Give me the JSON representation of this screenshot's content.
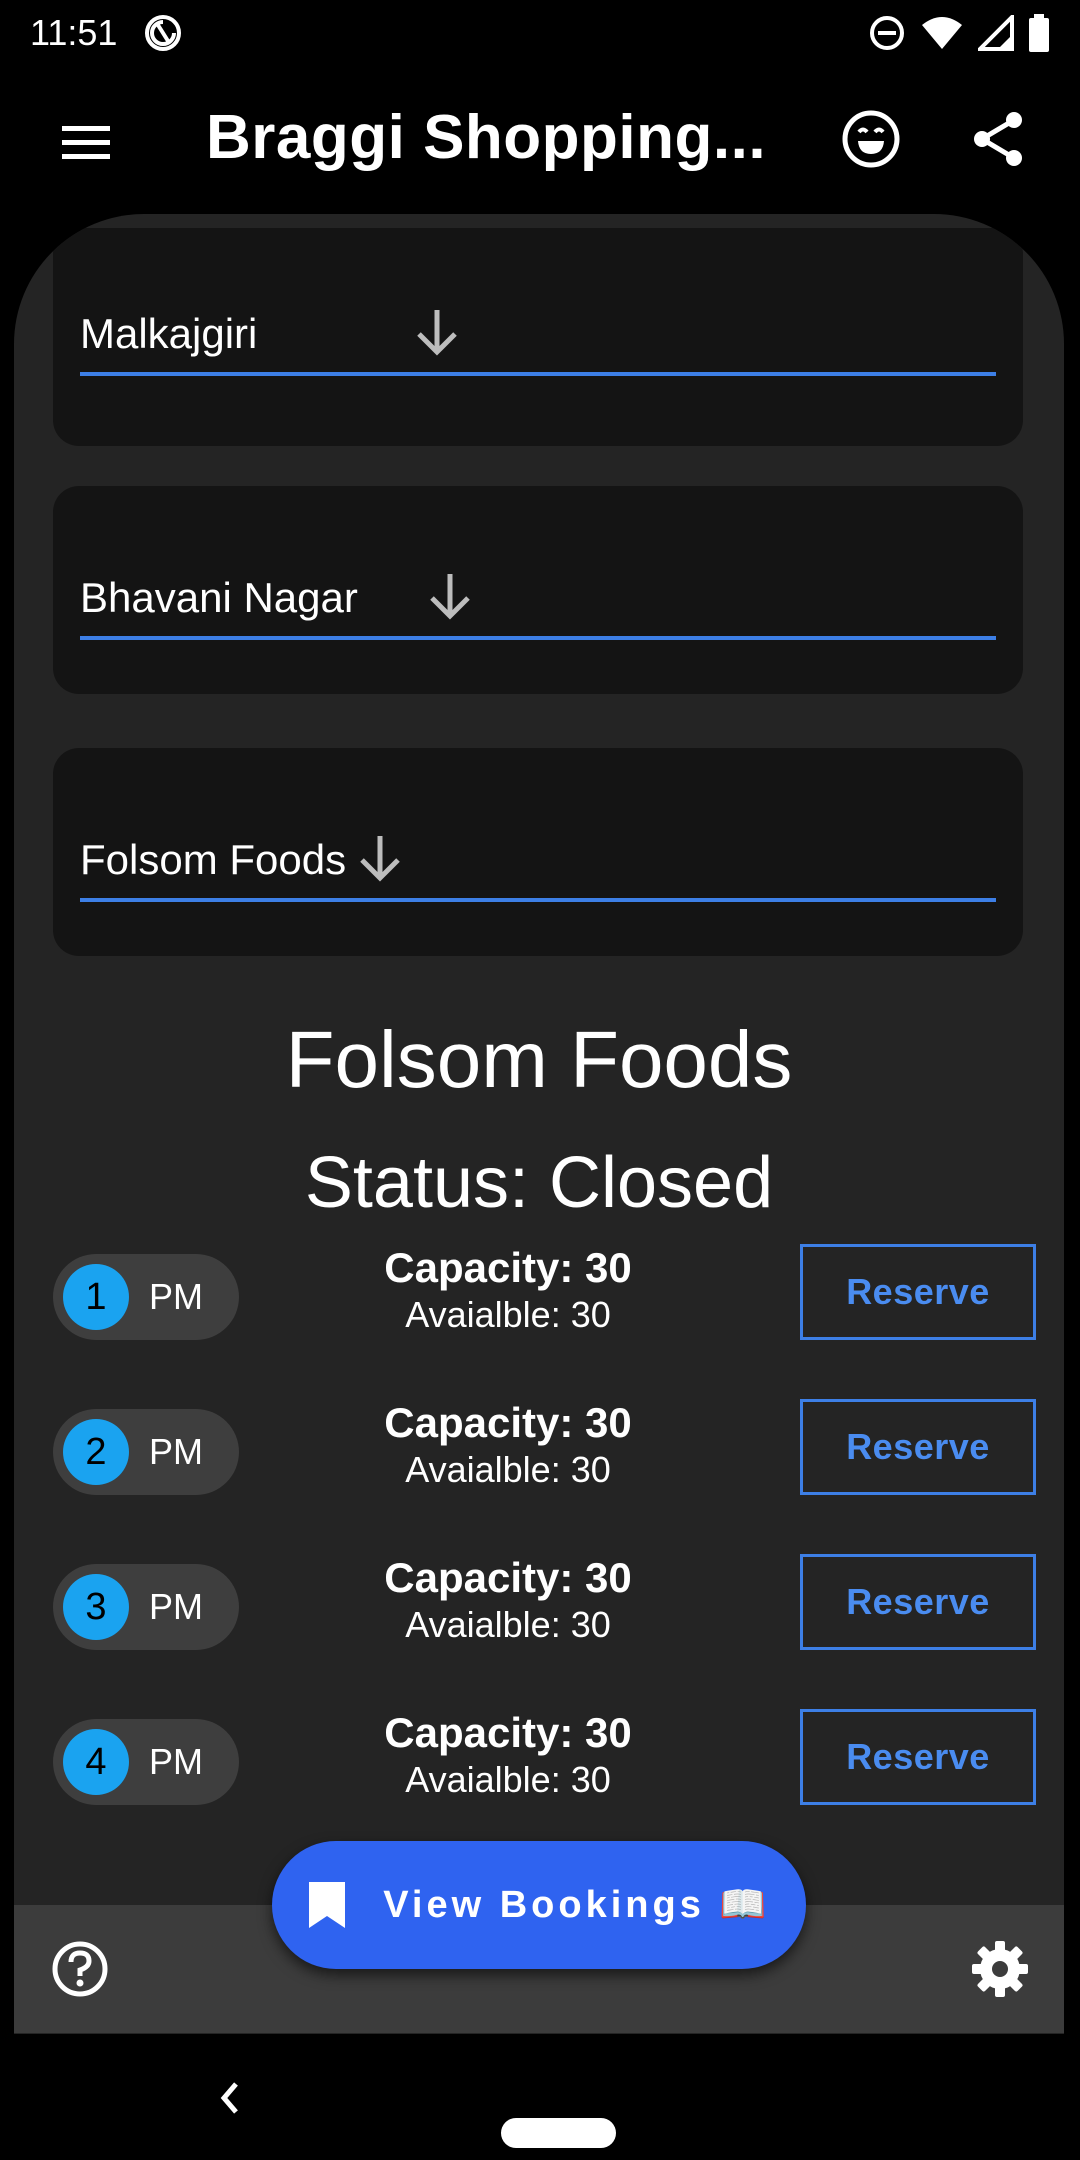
{
  "status_bar": {
    "time": "11:51",
    "icons": [
      "sync-icon",
      "do-not-disturb-icon",
      "wifi-icon",
      "signal-icon",
      "battery-icon"
    ]
  },
  "app_bar": {
    "title": "Braggi Shopping...",
    "icons": [
      "menu-icon",
      "emoji-icon",
      "share-icon"
    ]
  },
  "dropdowns": [
    {
      "value": "Malkajgiri"
    },
    {
      "value": "Bhavani Nagar"
    },
    {
      "value": "Folsom Foods"
    }
  ],
  "store": {
    "name": "Folsom Foods",
    "status": "Status: Closed"
  },
  "slots": [
    {
      "number": "1",
      "period": "PM",
      "capacity": "Capacity: 30",
      "available": "Avaialble: 30",
      "action": "Reserve"
    },
    {
      "number": "2",
      "period": "PM",
      "capacity": "Capacity: 30",
      "available": "Avaialble: 30",
      "action": "Reserve"
    },
    {
      "number": "3",
      "period": "PM",
      "capacity": "Capacity: 30",
      "available": "Avaialble: 30",
      "action": "Reserve"
    },
    {
      "number": "4",
      "period": "PM",
      "capacity": "Capacity: 30",
      "available": "Avaialble: 30",
      "action": "Reserve"
    }
  ],
  "fab": {
    "label": "View Bookings 📖",
    "icon": "bookmark-icon"
  },
  "bottom_bar": {
    "icons": [
      "help-icon",
      "settings-icon"
    ]
  },
  "colors": {
    "accent": "#3d7fe6",
    "fab": "#2f63f0",
    "slot_badge": "#1aa3f0",
    "panel": "#242424",
    "card": "#141414"
  }
}
